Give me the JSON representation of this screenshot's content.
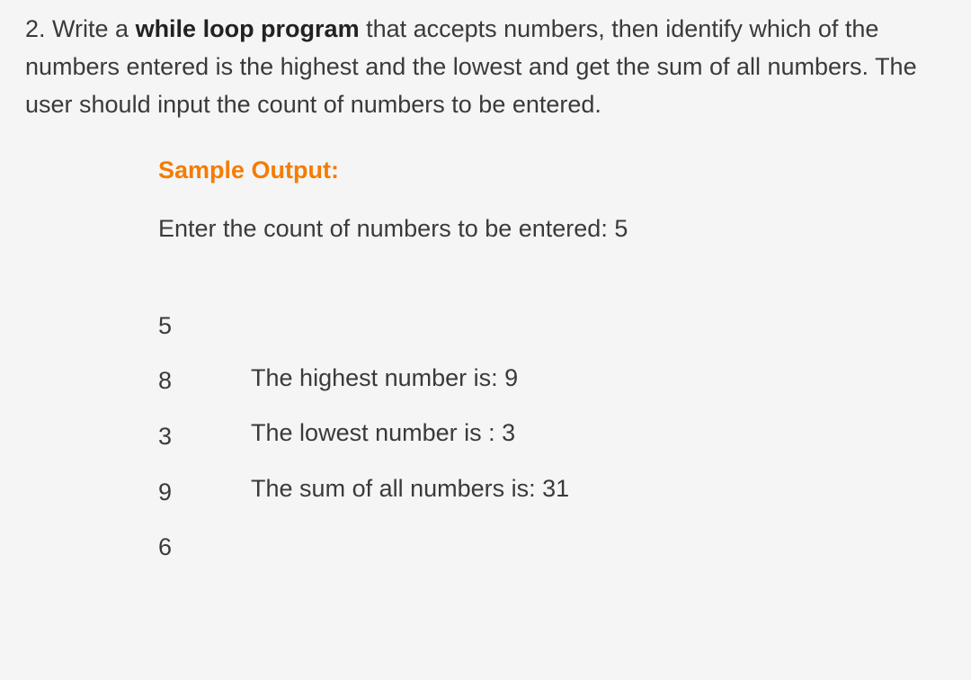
{
  "question": {
    "number": "2.",
    "text_before_bold": " Write a ",
    "bold_text": "while loop program",
    "text_after_bold": " that accepts numbers, then identify which of the numbers entered is the highest and the lowest and get the sum of all numbers. The user should input the count of numbers to be entered."
  },
  "sample_output_heading": "Sample Output:",
  "prompt_line": "Enter the count of numbers to be entered: 5",
  "input_numbers": [
    "5",
    "8",
    "3",
    "9",
    "6"
  ],
  "results": [
    "The highest number is: 9",
    "The lowest number is : 3",
    "The sum of all numbers is: 31"
  ]
}
